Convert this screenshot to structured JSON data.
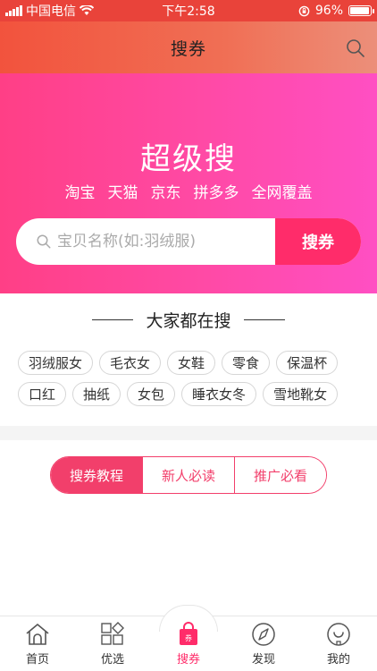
{
  "status_bar": {
    "carrier": "中国电信",
    "time": "下午2:58",
    "battery": "96%",
    "battery_level": 0.96
  },
  "nav": {
    "title": "搜券",
    "search_icon": "search-icon"
  },
  "hero": {
    "title": "超级搜",
    "platforms": [
      "淘宝",
      "天猫",
      "京东",
      "拼多多",
      "全网覆盖"
    ],
    "search_placeholder": "宝贝名称(如:羽绒服)",
    "search_button": "搜券"
  },
  "hot_search": {
    "title": "大家都在搜",
    "rows": [
      [
        "羽绒服女",
        "毛衣女",
        "女鞋",
        "零食",
        "保温杯"
      ],
      [
        "口红",
        "抽纸",
        "女包",
        "睡衣女冬",
        "雪地靴女"
      ]
    ]
  },
  "guide_tabs": {
    "items": [
      "搜券教程",
      "新人必读",
      "推广必看"
    ],
    "active": "搜券教程"
  },
  "tab_bar": {
    "items": [
      {
        "label": "首页",
        "icon": "home-icon"
      },
      {
        "label": "优选",
        "icon": "grid-icon"
      },
      {
        "label": "搜券",
        "icon": "coupon-bag-icon"
      },
      {
        "label": "发现",
        "icon": "compass-icon"
      },
      {
        "label": "我的",
        "icon": "profile-icon"
      }
    ],
    "active": "搜券"
  },
  "colors": {
    "status_bar": "#e9433a",
    "hero_start": "#ff3f86",
    "hero_end": "#ff4fc3",
    "accent": "#ff2c6a",
    "segment_accent": "#f23f6b"
  }
}
